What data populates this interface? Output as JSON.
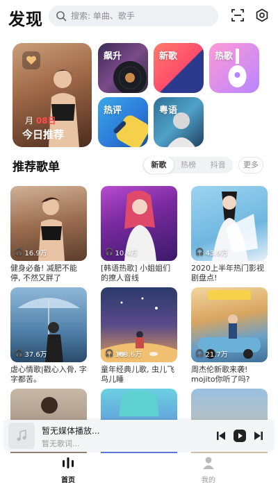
{
  "header": {
    "title": "发现",
    "search_placeholder": "搜索: 单曲、歌手"
  },
  "categories": {
    "featured": {
      "date_prefix": "月",
      "date_value": "08日",
      "label": "今日推荐"
    },
    "items": [
      {
        "label": "飙升"
      },
      {
        "label": "新歌"
      },
      {
        "label": "热歌"
      },
      {
        "label": "热评"
      },
      {
        "label": "粤语"
      }
    ]
  },
  "section": {
    "title": "推荐歌单",
    "tabs": [
      {
        "label": "新歌",
        "active": true
      },
      {
        "label": "热榜",
        "active": false
      },
      {
        "label": "抖音",
        "active": false
      }
    ],
    "more_label": "更多"
  },
  "playlists": [
    {
      "plays": "16.9万",
      "caption": "健身必备! 减肥不能停, 不然又胖了"
    },
    {
      "plays": "10.4万",
      "caption": "[韩语热歌] 小姐姐们的撩人音线"
    },
    {
      "plays": "43.9万",
      "caption": "2020上半年热门影视剧盘点!"
    },
    {
      "plays": "37.6万",
      "caption": "虐心情歌|戳心入骨, 字字都苦。"
    },
    {
      "plays": "163.6万",
      "caption": "童年经典儿歌, 虫儿飞鸟儿睡"
    },
    {
      "plays": "21.7万",
      "caption": "周杰伦新歌来袭! mojito你听了吗?"
    },
    {
      "plays": "",
      "caption": ""
    },
    {
      "plays": "",
      "caption": ""
    },
    {
      "plays": "",
      "caption": ""
    }
  ],
  "player": {
    "title": "暂无媒体播放...",
    "artist": "暂无歌词..."
  },
  "nav": {
    "home_label": "首页",
    "me_label": "我的"
  },
  "colors": {
    "accent_red": "#ff4b4b",
    "search_bg": "#eef0f3"
  }
}
